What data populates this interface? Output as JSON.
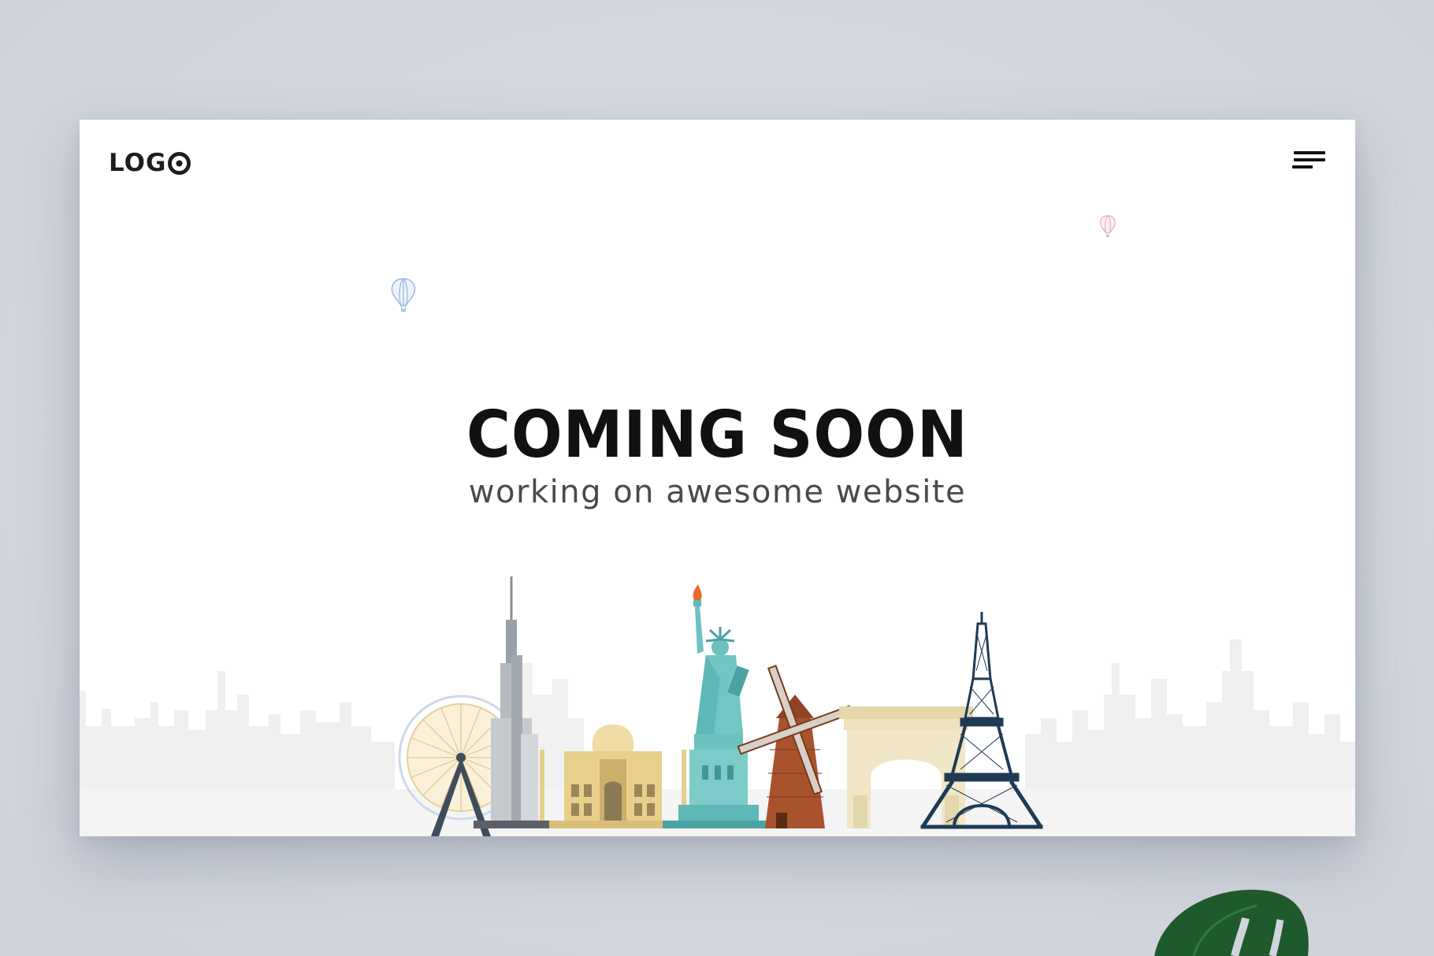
{
  "header": {
    "logo_text": "LOG",
    "logo_icon": "target-circle-icon",
    "menu_icon": "hamburger-menu-icon"
  },
  "hero": {
    "title": "COMING SOON",
    "subtitle": "working on awesome website"
  },
  "illustration": {
    "landmarks": [
      "london-eye",
      "burj-khalifa",
      "taj-mahal",
      "statue-of-liberty",
      "windmill",
      "arc-de-triomphe",
      "eiffel-tower"
    ],
    "balloons": [
      "blue-hot-air-balloon",
      "pink-hot-air-balloon"
    ]
  },
  "colors": {
    "background": "#d2d6de",
    "card": "#ffffff",
    "title": "#111111",
    "subtitle": "#4a4a4a",
    "skyline": "#ececec",
    "teal": "#5fb8b8",
    "gold": "#e8d08c"
  }
}
